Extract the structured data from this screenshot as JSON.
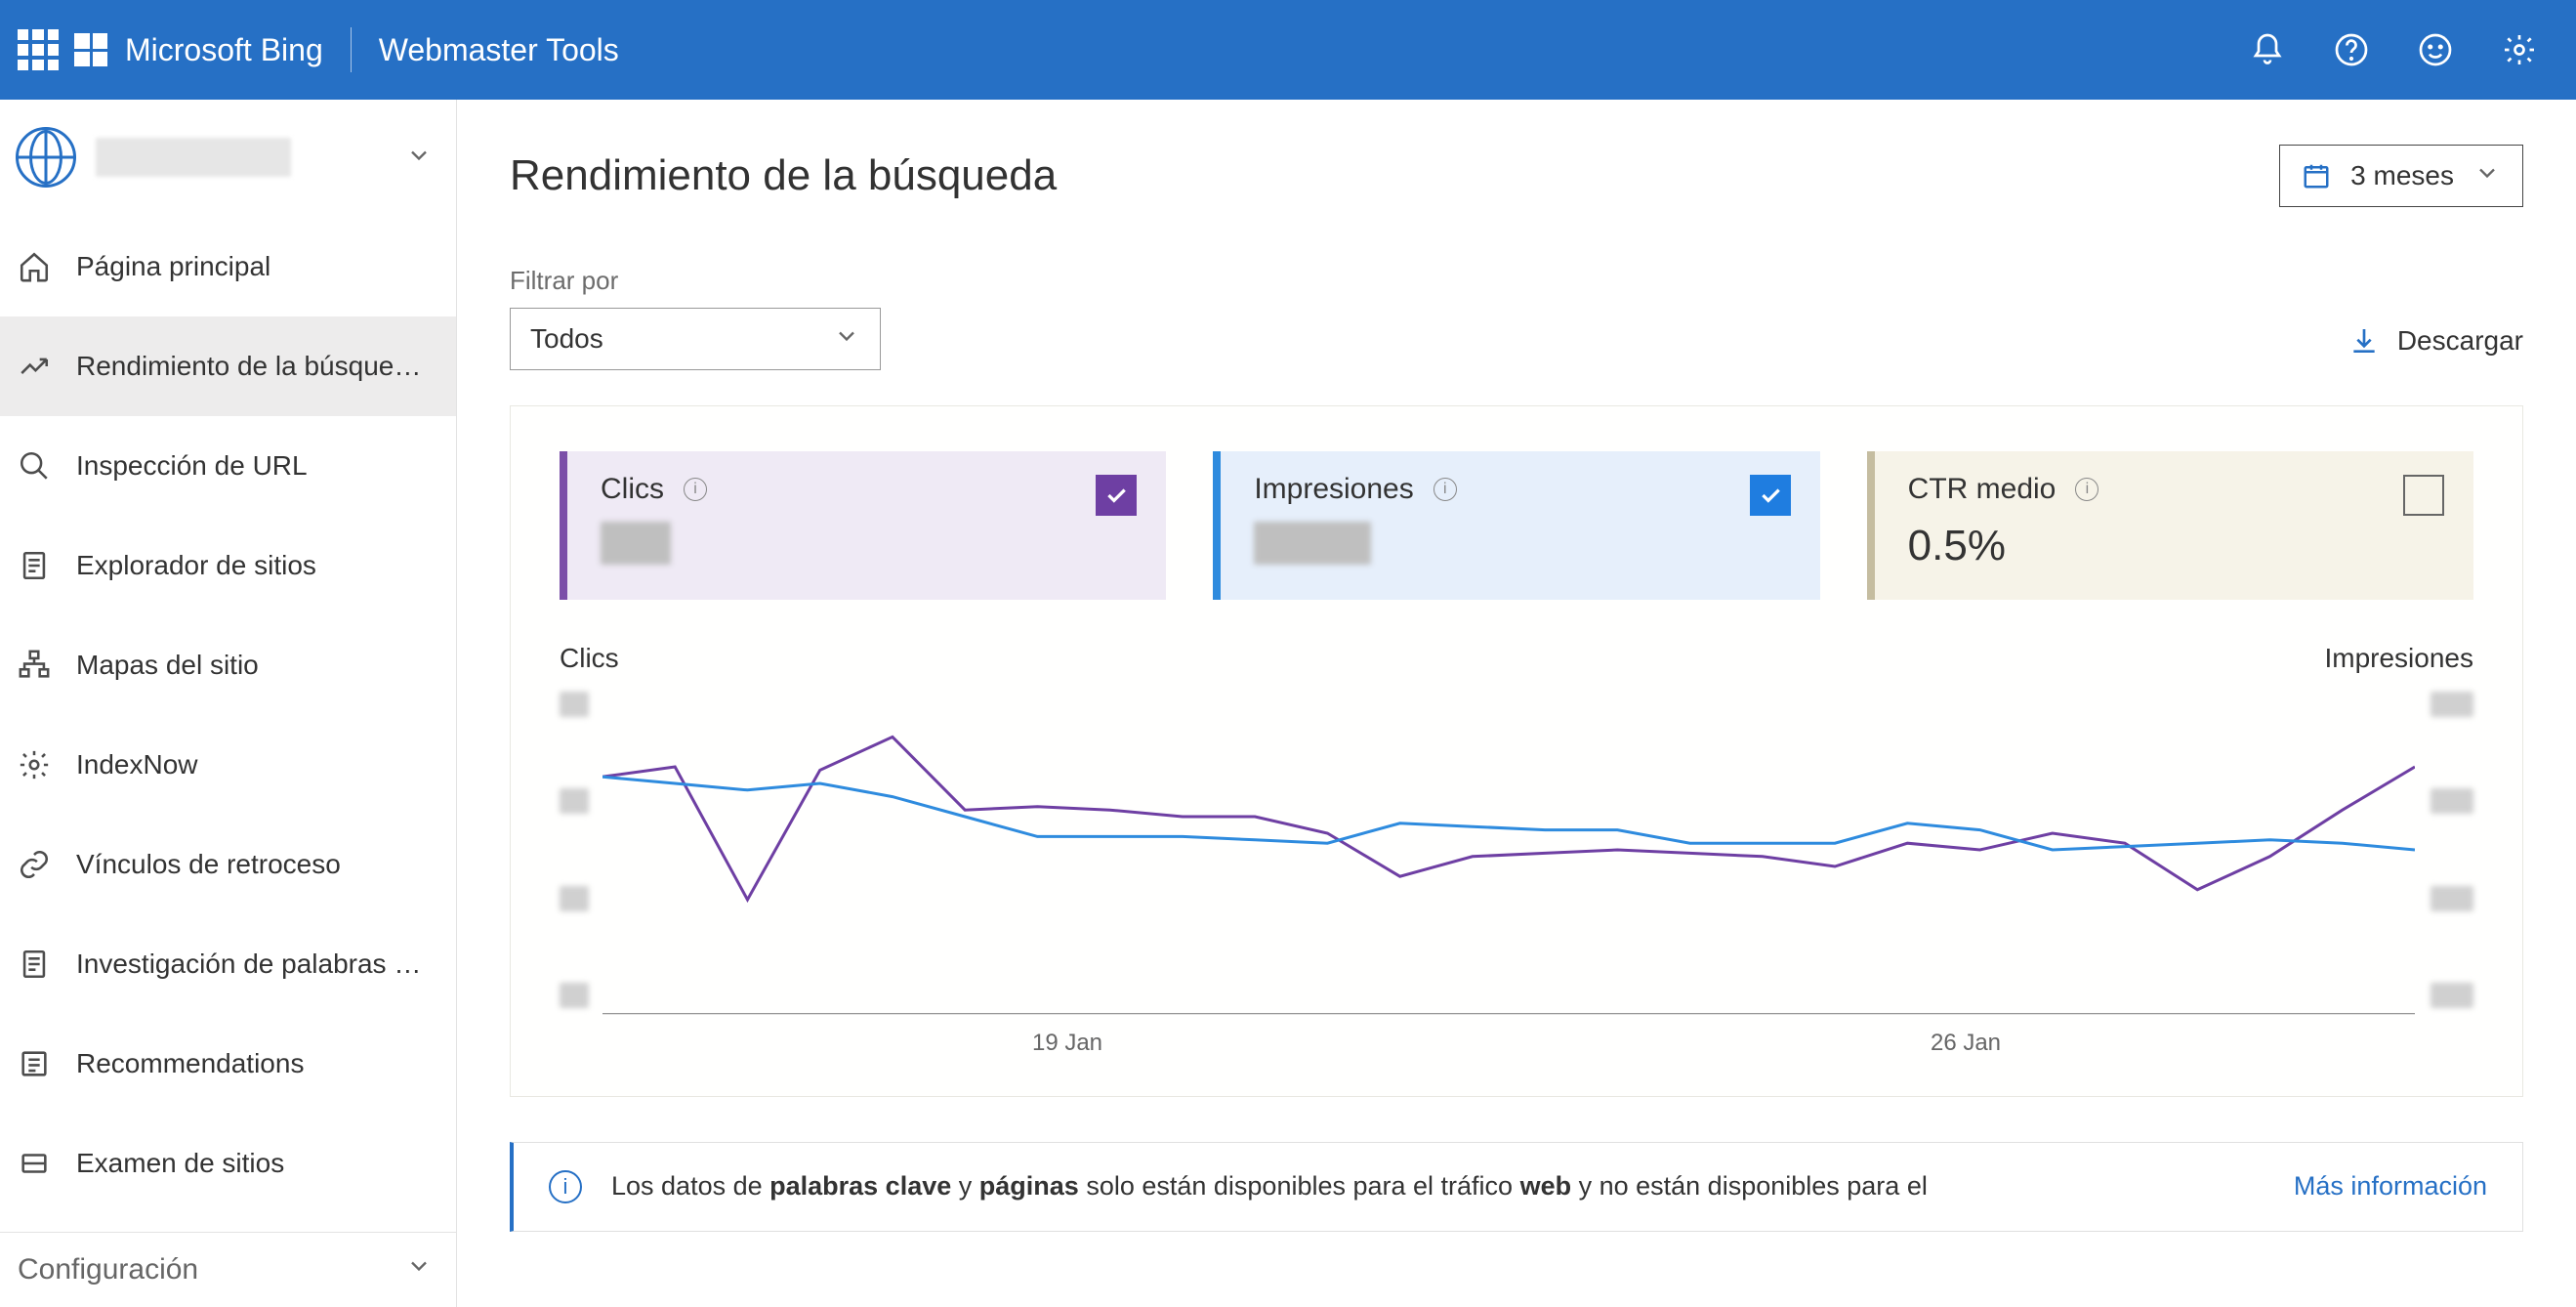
{
  "header": {
    "brand": "Microsoft Bing",
    "product": "Webmaster Tools"
  },
  "sidebar": {
    "items": [
      {
        "label": "Página principal",
        "icon": "home"
      },
      {
        "label": "Rendimiento de la búsque…",
        "icon": "trend",
        "active": true
      },
      {
        "label": "Inspección de URL",
        "icon": "search"
      },
      {
        "label": "Explorador de sitios",
        "icon": "doc"
      },
      {
        "label": "Mapas del sitio",
        "icon": "sitemap"
      },
      {
        "label": "IndexNow",
        "icon": "gear"
      },
      {
        "label": "Vínculos de retroceso",
        "icon": "link"
      },
      {
        "label": "Investigación de palabras …",
        "icon": "doc"
      },
      {
        "label": "Recommendations",
        "icon": "list"
      },
      {
        "label": "Examen de sitios",
        "icon": "scan"
      }
    ],
    "config": "Configuración"
  },
  "page": {
    "title": "Rendimiento de la búsqueda",
    "date_range": "3 meses",
    "filter_label": "Filtrar por",
    "filter_value": "Todos",
    "download": "Descargar"
  },
  "cards": {
    "clicks_label": "Clics",
    "impressions_label": "Impresiones",
    "ctr_label": "CTR medio",
    "ctr_value": "0.5%"
  },
  "chart_axes": {
    "left": "Clics",
    "right": "Impresiones"
  },
  "chart_data": {
    "type": "line",
    "x_ticks": [
      "19 Jan",
      "26 Jan"
    ],
    "series": [
      {
        "name": "Clics",
        "color": "#6e3fa3",
        "values": [
          72,
          75,
          35,
          74,
          84,
          62,
          63,
          62,
          60,
          60,
          55,
          42,
          48,
          49,
          50,
          49,
          48,
          45,
          52,
          50,
          55,
          52,
          38,
          48,
          62,
          75
        ]
      },
      {
        "name": "Impresiones",
        "color": "#2e8bde",
        "values": [
          72,
          70,
          68,
          70,
          66,
          60,
          54,
          54,
          54,
          53,
          52,
          58,
          57,
          56,
          56,
          52,
          52,
          52,
          58,
          56,
          50,
          51,
          52,
          53,
          52,
          50
        ]
      }
    ]
  },
  "banner": {
    "prefix": "Los datos de ",
    "bold1": "palabras clave",
    "mid1": " y ",
    "bold2": "páginas",
    "mid2": " solo están disponibles para el tráfico ",
    "bold3": "web",
    "suffix": " y no están disponibles para el",
    "more": "Más información"
  }
}
